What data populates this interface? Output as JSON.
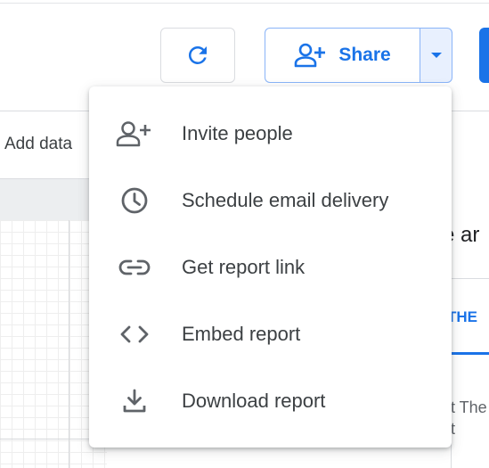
{
  "toolbar": {
    "share_label": "Share",
    "refresh_icon": "refresh-icon",
    "share_icon": "person-add-icon",
    "dropdown_icon": "arrow-drop-down-icon",
    "accent_color": "#1a73e8"
  },
  "background": {
    "add_data_label": "Add data",
    "right_panel": {
      "title_fragment": "e ar",
      "tab_fragment": "THE",
      "text_line1": "t The",
      "text_line2": "t"
    }
  },
  "share_menu": {
    "items": [
      {
        "label": "Invite people",
        "icon": "person-add-icon"
      },
      {
        "label": "Schedule email delivery",
        "icon": "schedule-clock-icon"
      },
      {
        "label": "Get report link",
        "icon": "link-icon"
      },
      {
        "label": "Embed report",
        "icon": "code-icon"
      },
      {
        "label": "Download report",
        "icon": "download-icon"
      }
    ]
  }
}
